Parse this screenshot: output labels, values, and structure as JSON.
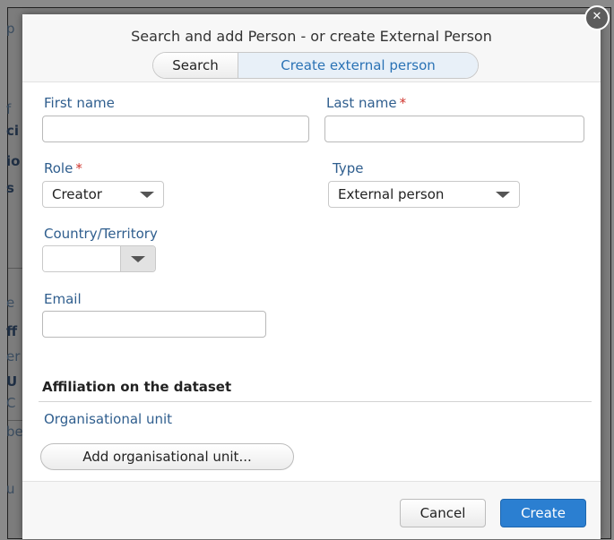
{
  "background": {
    "fragments": [
      {
        "text": "p",
        "bold": false
      },
      {
        "text": "f",
        "bold": false
      },
      {
        "text": "ci",
        "bold": true
      },
      {
        "text": "io",
        "bold": true
      },
      {
        "text": "s",
        "bold": true
      },
      {
        "text": "e",
        "bold": false
      },
      {
        "text": "ff",
        "bold": true
      },
      {
        "text": "er",
        "bold": false
      },
      {
        "text": "U",
        "bold": true
      },
      {
        "text": "C",
        "bold": false
      },
      {
        "text": "be",
        "bold": false
      },
      {
        "text": "u",
        "bold": false
      }
    ]
  },
  "dialog": {
    "title": "Search and add Person - or create External Person",
    "close_glyph": "✕",
    "tabs": {
      "search": "Search",
      "create": "Create external person"
    },
    "form": {
      "first_name_label": "First name",
      "first_name_value": "",
      "last_name_label": "Last name",
      "last_name_value": "",
      "required_mark": "*",
      "role_label": "Role",
      "role_value": "Creator",
      "type_label": "Type",
      "type_value": "External person",
      "country_label": "Country/Territory",
      "country_value": "",
      "email_label": "Email",
      "email_value": ""
    },
    "affiliation": {
      "section_title": "Affiliation on the dataset",
      "org_unit_label": "Organisational unit",
      "add_button": "Add organisational unit..."
    },
    "footer": {
      "cancel": "Cancel",
      "create": "Create"
    }
  },
  "colors": {
    "label_blue": "#2f5e8e",
    "required_red": "#d0342c",
    "primary_button": "#2b7fd1"
  }
}
